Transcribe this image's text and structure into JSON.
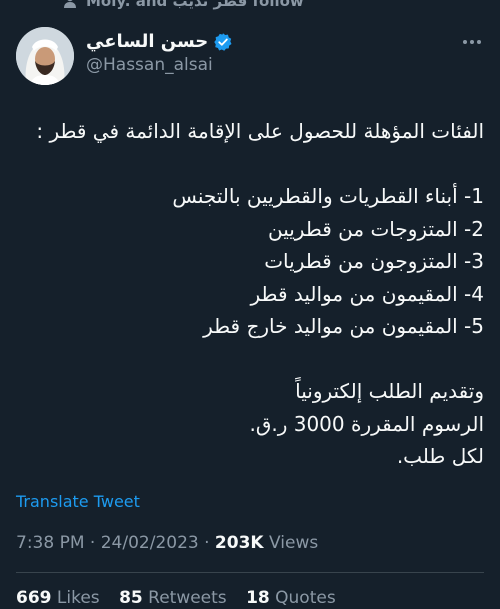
{
  "social_context": {
    "text": "Moly. and قطر تذيب follow",
    "icon": "person-icon"
  },
  "author": {
    "display_name": "حسن الساعي",
    "handle": "@Hassan_alsai",
    "verified": true,
    "verified_color": "#1d9bf0"
  },
  "more_menu": {
    "icon": "more-icon"
  },
  "tweet": {
    "heading": "الفئات المؤهلة للحصول على الإقامة الدائمة في قطر :",
    "items": [
      "1- أبناء القطريات والقطريين بالتجنس",
      "2- المتزوجات من قطريين",
      "3- المتزوجون من قطريات",
      "4- المقيمون من مواليد قطر",
      "5- المقيمون من مواليد خارج قطر"
    ],
    "footer_lines": [
      "وتقديم الطلب إلكترونياً",
      "الرسوم المقررة 3000 ر.ق.",
      "لكل طلب."
    ]
  },
  "translate_label": "Translate Tweet",
  "meta": {
    "time": "7:38 PM",
    "separator": " · ",
    "date": "24/02/2023",
    "views_count": "203K",
    "views_label": "Views"
  },
  "stats": {
    "likes_count": "669",
    "likes_label": "Likes",
    "retweets_count": "85",
    "retweets_label": "Retweets",
    "quotes_count": "18",
    "quotes_label": "Quotes"
  },
  "colors": {
    "background": "#15202b",
    "text_primary": "#f7f9f9",
    "text_secondary": "#8b98a5",
    "link": "#1d9bf0",
    "divider": "#38444d"
  }
}
